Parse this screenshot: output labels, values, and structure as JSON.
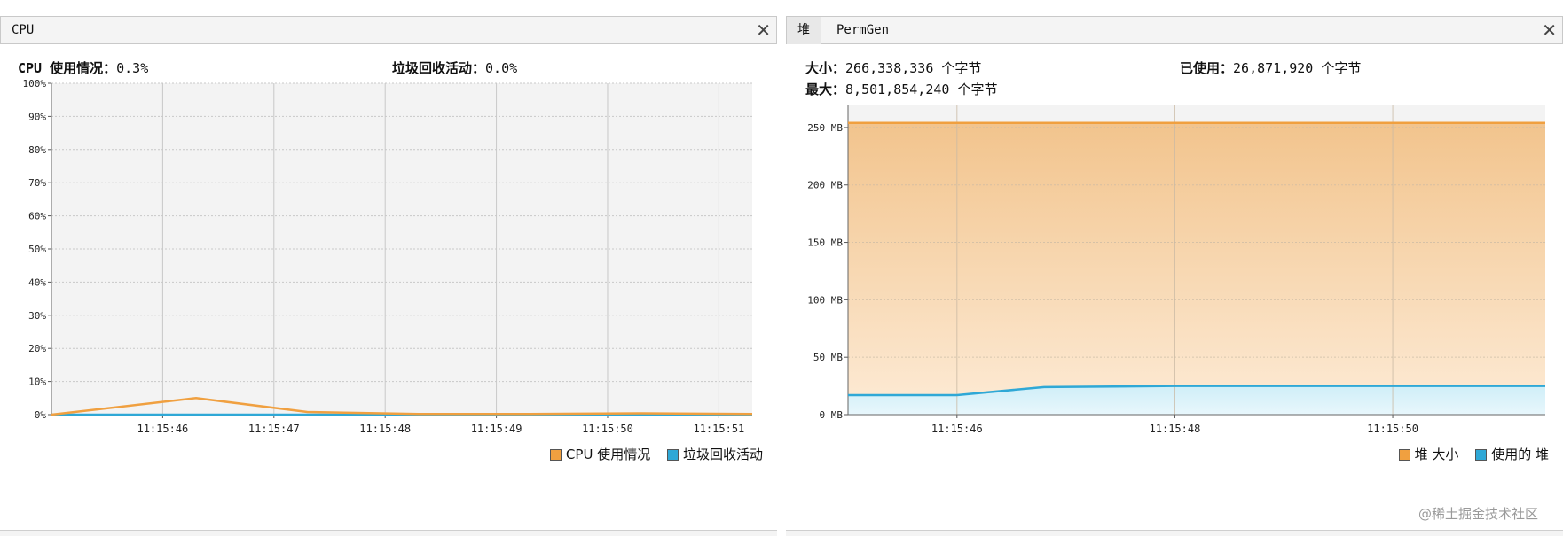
{
  "cpu_panel": {
    "tab_label": "CPU",
    "usage_label": "CPU 使用情况：",
    "usage_value": "0.3%",
    "gc_label": "垃圾回收活动：",
    "gc_value": "0.0%",
    "legend": [
      "CPU 使用情况",
      "垃圾回收活动"
    ]
  },
  "mem_panel": {
    "tabs": [
      "堆",
      "PermGen"
    ],
    "size_label": "大小：",
    "size_value": "266,338,336 个字节",
    "used_label": "已使用：",
    "used_value": "26,871,920 个字节",
    "max_label": "最大：",
    "max_value": "8,501,854,240 个字节",
    "legend": [
      "堆 大小",
      "使用的 堆"
    ]
  },
  "watermark": "@稀土掘金技术社区",
  "colors": {
    "orange": "#f0a040",
    "blue": "#2fa8d6",
    "plot_bg": "#f3f3f3"
  },
  "chart_data": [
    {
      "type": "line",
      "title": "",
      "y_unit": "%",
      "ylim": [
        0,
        100
      ],
      "y_ticks": [
        "0%",
        "10%",
        "20%",
        "30%",
        "40%",
        "50%",
        "60%",
        "70%",
        "80%",
        "90%",
        "100%"
      ],
      "x_ticks": [
        "11:15:46",
        "11:15:47",
        "11:15:48",
        "11:15:49",
        "11:15:50",
        "11:15:51"
      ],
      "grid": true,
      "legend_position": "bottom-right",
      "series": [
        {
          "name": "CPU 使用情况",
          "color": "#f0a040",
          "t": [
            "11:15:45.0",
            "11:15:46.3",
            "11:15:47.3",
            "11:15:48.3",
            "11:15:49.3",
            "11:15:50.3",
            "11:15:51.3"
          ],
          "values": [
            0,
            5,
            0.8,
            0.2,
            0.2,
            0.4,
            0.2
          ]
        },
        {
          "name": "垃圾回收活动",
          "color": "#2fa8d6",
          "t": [
            "11:15:45.0",
            "11:15:51.3"
          ],
          "values": [
            0,
            0
          ]
        }
      ]
    },
    {
      "type": "area",
      "title": "",
      "y_unit": "MB",
      "ylim": [
        0,
        270
      ],
      "y_ticks": [
        "0 MB",
        "50 MB",
        "100 MB",
        "150 MB",
        "200 MB",
        "250 MB"
      ],
      "x_ticks": [
        "11:15:46",
        "11:15:48",
        "11:15:50"
      ],
      "grid": true,
      "legend_position": "bottom-right",
      "series": [
        {
          "name": "堆 大小",
          "color": "#f0a040",
          "t": [
            "11:15:45.0",
            "11:15:51.4"
          ],
          "values": [
            254,
            254
          ]
        },
        {
          "name": "使用的 堆",
          "color": "#2fa8d6",
          "t": [
            "11:15:45.0",
            "11:15:46.0",
            "11:15:46.8",
            "11:15:48.0",
            "11:15:51.4"
          ],
          "values": [
            17,
            17,
            24,
            25,
            25
          ]
        }
      ]
    }
  ]
}
